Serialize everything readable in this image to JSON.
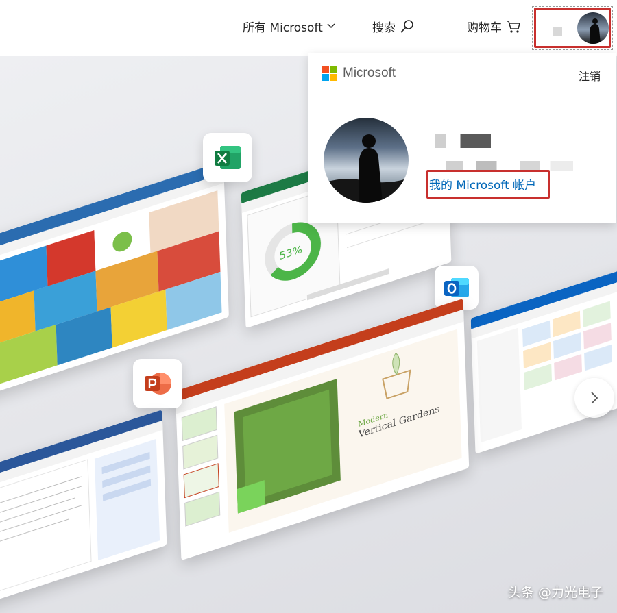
{
  "nav": {
    "all_microsoft": "所有 Microsoft",
    "search": "搜索",
    "cart": "购物车"
  },
  "account_panel": {
    "brand": "Microsoft",
    "sign_out": "注销",
    "account_link": "我的 Microsoft 帐户"
  },
  "hero": {
    "excel_donut_label": "53%",
    "slide_title_line1": "Modern",
    "slide_title_line2": "Vertical Gardens"
  },
  "watermark": "头条 @力光电子",
  "icons": {
    "chevron": "chevron-down-icon",
    "search": "search-icon",
    "cart": "cart-icon",
    "next": "chevron-right-icon"
  },
  "colors": {
    "accent_link": "#0067b8",
    "highlight_red": "#c8302e",
    "excel_green": "#1d7a45",
    "powerpoint_red": "#c43e1c",
    "outlook_blue": "#0a64c2"
  }
}
